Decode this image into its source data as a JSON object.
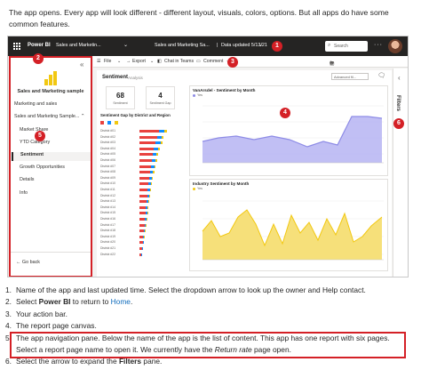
{
  "intro": "The app opens. Every app will look different - different layout, visuals, colors, options. But all apps do have some common features.",
  "colors": {
    "callout": "#d42026",
    "topbar": "#252423",
    "link": "#0f6cbd",
    "area_chart": "#8e8ce6",
    "area_chart_fill": "#b6b4f2",
    "yellow_chart": "#f2c811",
    "accent_yellow": "#f2c811"
  },
  "topbar": {
    "product": "Power BI",
    "app_name": "Sales and Marketin...",
    "report_title": "Sales and Marketing Sa...",
    "separator": "|",
    "updated": "Data updated 5/13/21",
    "search_placeholder": "Search",
    "icons": [
      "app-launcher-icon",
      "chevron-down-icon",
      "search-icon",
      "more-icon",
      "avatar"
    ]
  },
  "nav": {
    "app_title": "Sales and Marketing sample",
    "items": [
      {
        "label": "Marketing and sales"
      },
      {
        "label": "Sales and Marketing Sample..."
      },
      {
        "label": "Market Share"
      },
      {
        "label": "YTD Category"
      },
      {
        "label": "Sentiment"
      },
      {
        "label": "Growth Opportunities"
      },
      {
        "label": "Details"
      },
      {
        "label": "Info"
      }
    ],
    "active_item": "Sentiment",
    "back_label": "Go back"
  },
  "action_bar": {
    "file": "File",
    "export": "Export",
    "chat": "Chat in Teams",
    "comment": "Comment",
    "more": "···"
  },
  "canvas": {
    "title": "Sentiment",
    "subtitle": "Analysis",
    "filter_button": "Advanced fil...",
    "cards": [
      {
        "value": "68",
        "label": "Sentiment"
      },
      {
        "value": "4",
        "label": "Sentiment Gap"
      }
    ],
    "bar_section_title": "Sentiment Gap by District and Region",
    "bar_legend_colors": [
      "#e8423f",
      "#118dff",
      "#f2c811"
    ],
    "district_labels": [
      "District #01",
      "District #02",
      "District #03",
      "District #04",
      "District #05",
      "District #06",
      "District #07",
      "District #08",
      "District #09",
      "District #10",
      "District #11",
      "District #12",
      "District #13",
      "District #14",
      "District #15",
      "District #16",
      "District #17",
      "District #18",
      "District #19",
      "District #20",
      "District #21",
      "District #22"
    ],
    "line_chart_title": "VanArsdel - Sentiment by Month",
    "line_legend": "Yes",
    "yellow_chart_title": "Industry Sentiment by Month",
    "yellow_legend": "Yes"
  },
  "filters_label": "Filters",
  "callouts": [
    "1",
    "2",
    "3",
    "4",
    "5",
    "6"
  ],
  "steps": [
    {
      "n": "1.",
      "text": "Name of the app and last updated time. Select the dropdown arrow to look up the owner and Help contact."
    },
    {
      "n": "2.",
      "pre": "Select ",
      "bold": "Power BI",
      "mid": " to return to ",
      "link": "Home",
      "post": "."
    },
    {
      "n": "3.",
      "text": "Your action bar."
    },
    {
      "n": "4.",
      "text": "The report page canvas."
    },
    {
      "n": "5.",
      "text": "The app navigation pane. Below the name of the app is the list of content. This app has one report with six pages."
    },
    {
      "n": "",
      "pre": "Select a report page name to open it. We currently have the ",
      "em": "Return rate",
      "post": " page open."
    },
    {
      "n": "6.",
      "pre": "Select the arrow to expand the ",
      "bold": "Filters",
      "post": " pane."
    }
  ]
}
